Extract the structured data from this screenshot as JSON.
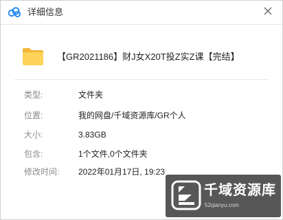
{
  "window": {
    "title": "详细信息",
    "close_icon": "close-icon",
    "app_icon": "cloud-icon",
    "accent_color": "#2b8cf0"
  },
  "file": {
    "icon": "folder-icon",
    "name": "【GR2021186】财J女X20T投Z实Z课【完结】"
  },
  "details": [
    {
      "label": "类型:",
      "value": "文件夹"
    },
    {
      "label": "位置:",
      "value": "我的网盘/千域资源库/GR个人"
    },
    {
      "label": "大小:",
      "value": "3.83GB"
    },
    {
      "label": "包含:",
      "value": "1个文件,0个文件夹"
    },
    {
      "label": "修改时间:",
      "value": "2022年01月17日, 19:23"
    }
  ],
  "watermark": {
    "name": "千域资源库",
    "url": "52qianyu.com"
  }
}
